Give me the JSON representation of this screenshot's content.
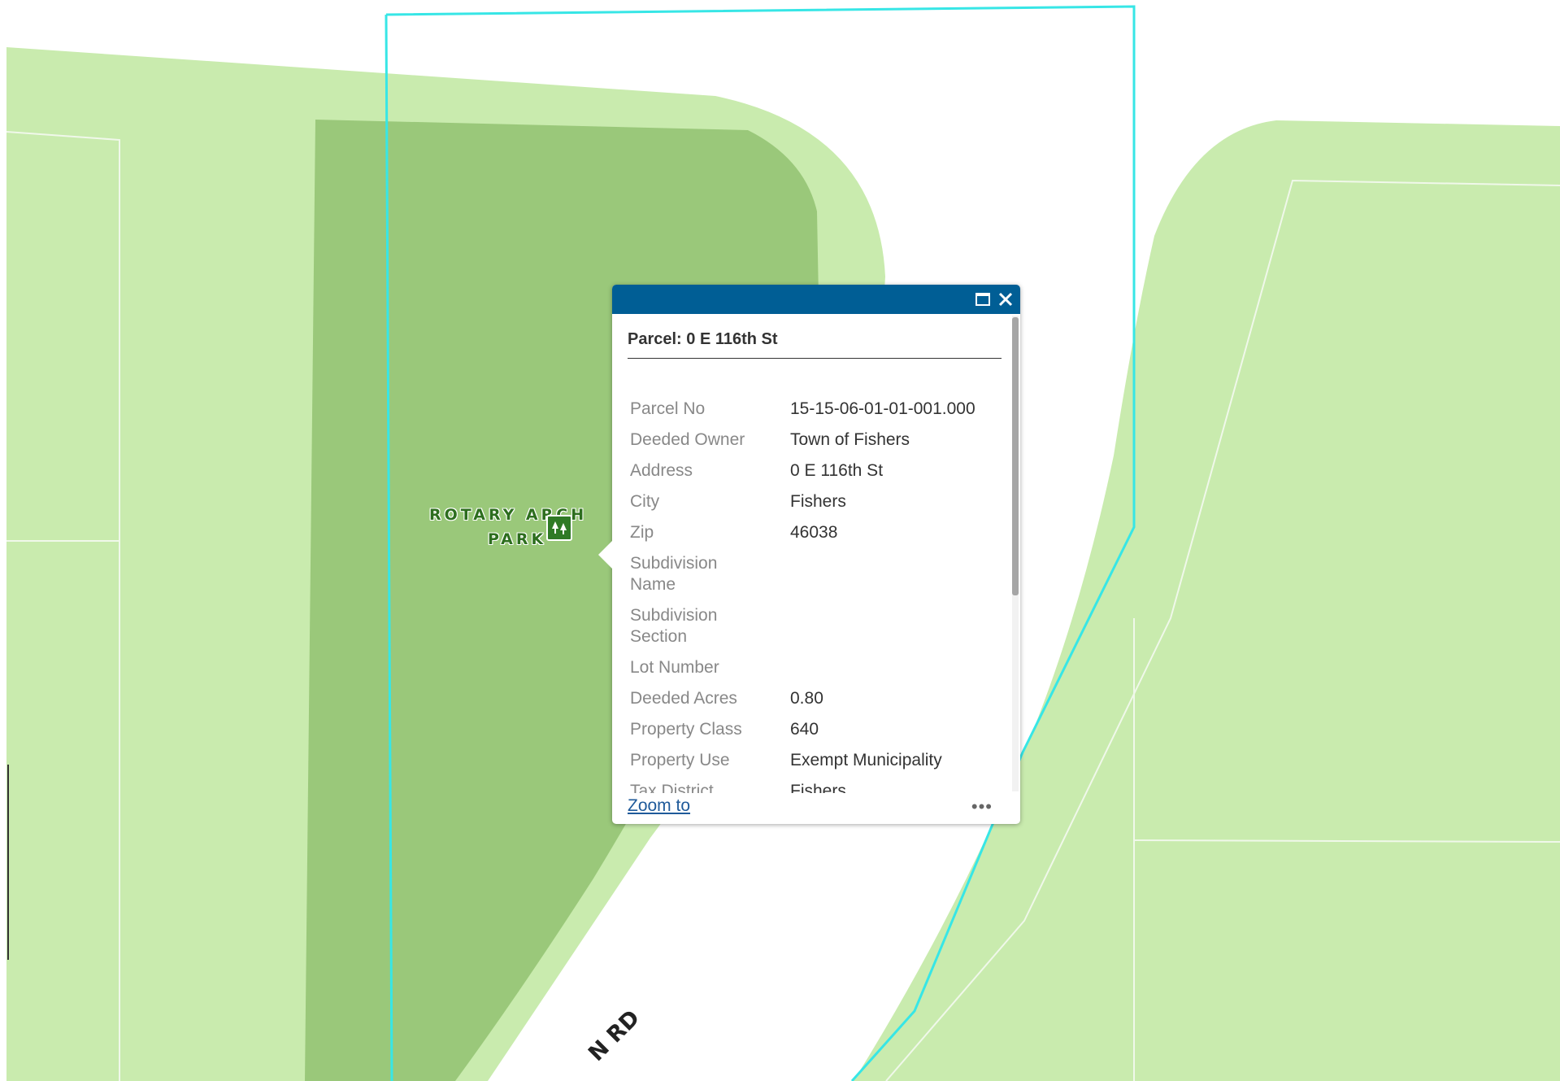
{
  "map": {
    "park_label_line1": "ROTARY ARCH",
    "park_label_line2": "PARK",
    "road_label": "N RD",
    "colors": {
      "park_light": "#c9ebae",
      "park_dark": "#9ac87a",
      "parcel_outline": "#37e6e6",
      "parcel_line": "#f0f8ea",
      "road": "#ffffff"
    }
  },
  "popup": {
    "header_color": "#005e95",
    "maximize_icon": "maximize-icon",
    "close_icon": "close-icon",
    "title": "Parcel: 0 E 116th St",
    "fields": [
      {
        "label": "Parcel No",
        "value": "15-15-06-01-01-001.000"
      },
      {
        "label": "Deeded Owner",
        "value": "Town of Fishers"
      },
      {
        "label": "Address",
        "value": "0 E 116th St"
      },
      {
        "label": "City",
        "value": "Fishers"
      },
      {
        "label": "Zip",
        "value": "46038"
      },
      {
        "label": "Subdivision Name",
        "value": ""
      },
      {
        "label": "Subdivision Section",
        "value": ""
      },
      {
        "label": "Lot Number",
        "value": ""
      },
      {
        "label": "Deeded Acres",
        "value": "0.80"
      },
      {
        "label": "Property Class",
        "value": "640"
      },
      {
        "label": "Property Use",
        "value": "Exempt Municipality"
      },
      {
        "label": "Tax District",
        "value": "Fishers"
      }
    ],
    "zoom_to_label": "Zoom to",
    "more_label": "•••"
  }
}
